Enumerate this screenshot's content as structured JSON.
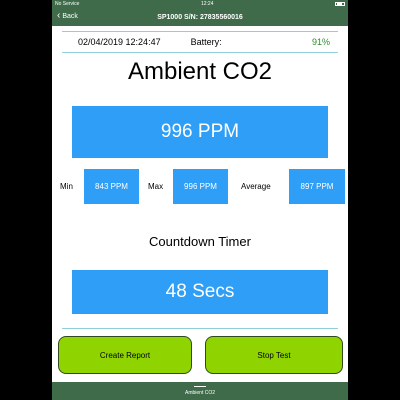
{
  "status_bar": {
    "carrier": "No Service",
    "time": "12:24"
  },
  "nav": {
    "back_label": "Back",
    "title": "SP1000 S/N: 27835560016"
  },
  "info": {
    "datetime": "02/04/2019 12:24:47",
    "battery_label": "Battery:",
    "battery_value": "91%"
  },
  "main": {
    "title": "Ambient CO2",
    "ppm_value": "996 PPM",
    "min_label": "Min",
    "min_value": "843 PPM",
    "max_label": "Max",
    "max_value": "996 PPM",
    "avg_label": "Average",
    "avg_value": "897 PPM",
    "countdown_title": "Countdown Timer",
    "countdown_value": "48 Secs"
  },
  "buttons": {
    "create_report": "Create Report",
    "stop_test": "Stop Test"
  },
  "footer": {
    "tab_label": "Ambient CO2"
  },
  "colors": {
    "header": "#3f6b4a",
    "accent_blue": "#2e9ef7",
    "button_green": "#8fd400",
    "battery_green": "#2e8b2e"
  }
}
